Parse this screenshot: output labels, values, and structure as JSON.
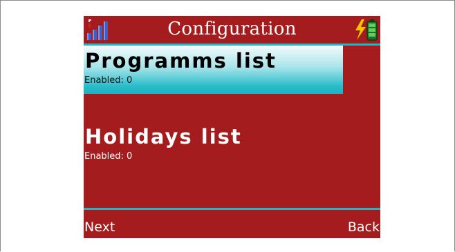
{
  "header": {
    "title": "Configuration",
    "left_icon": "signal-strength-icon",
    "right_icon": "battery-charging-icon"
  },
  "menu": {
    "items": [
      {
        "label": "Programms list",
        "status": "Enabled: 0",
        "selected": true
      },
      {
        "label": "Holidays list",
        "status": "Enabled: 0",
        "selected": false
      }
    ]
  },
  "softkeys": {
    "left": "Next",
    "right": "Back"
  },
  "colors": {
    "background": "#a41c1e",
    "accent": "#1fb7c6",
    "selection_start": "#f3fbfc",
    "selection_end": "#1eb0be",
    "text": "#ffffff"
  }
}
